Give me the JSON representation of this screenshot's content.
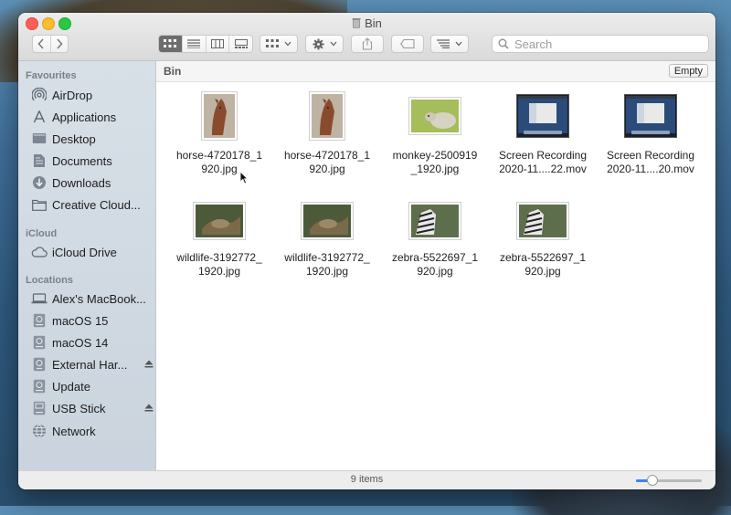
{
  "window": {
    "title": "Bin"
  },
  "toolbar": {
    "back_icon": "chevron-left-icon",
    "forward_icon": "chevron-right-icon",
    "view_modes": [
      "icon-view",
      "list-view",
      "column-view",
      "gallery-view"
    ],
    "active_view": "icon-view",
    "search_placeholder": "Search"
  },
  "sidebar": {
    "favourites_title": "Favourites",
    "favourites": [
      {
        "label": "AirDrop",
        "icon": "airdrop-icon"
      },
      {
        "label": "Applications",
        "icon": "applications-icon"
      },
      {
        "label": "Desktop",
        "icon": "desktop-icon"
      },
      {
        "label": "Documents",
        "icon": "documents-icon"
      },
      {
        "label": "Downloads",
        "icon": "downloads-icon"
      },
      {
        "label": "Creative Cloud...",
        "icon": "folder-icon"
      }
    ],
    "icloud_title": "iCloud",
    "icloud": [
      {
        "label": "iCloud Drive",
        "icon": "cloud-icon"
      }
    ],
    "locations_title": "Locations",
    "locations": [
      {
        "label": "Alex's MacBook...",
        "icon": "laptop-icon"
      },
      {
        "label": "macOS 15",
        "icon": "disk-icon"
      },
      {
        "label": "macOS 14",
        "icon": "disk-icon"
      },
      {
        "label": "External Har...",
        "icon": "external-disk-icon",
        "eject": true
      },
      {
        "label": "Update",
        "icon": "disk-icon"
      },
      {
        "label": "USB Stick",
        "icon": "usb-icon",
        "eject": true
      },
      {
        "label": "Network",
        "icon": "network-icon"
      }
    ]
  },
  "content": {
    "path_label": "Bin",
    "empty_button": "Empty",
    "files": [
      {
        "line1": "horse-4720178_1",
        "line2": "920.jpg",
        "kind": "horse"
      },
      {
        "line1": "horse-4720178_1",
        "line2": "920.jpg",
        "kind": "horse"
      },
      {
        "line1": "monkey-2500919",
        "line2": "_1920.jpg",
        "kind": "monkey"
      },
      {
        "line1": "Screen Recording",
        "line2": "2020-11....22.mov",
        "kind": "screen"
      },
      {
        "line1": "Screen Recording",
        "line2": "2020-11....20.mov",
        "kind": "screen"
      },
      {
        "line1": "wildlife-3192772_",
        "line2": "1920.jpg",
        "kind": "wildlife"
      },
      {
        "line1": "wildlife-3192772_",
        "line2": "1920.jpg",
        "kind": "wildlife"
      },
      {
        "line1": "zebra-5522697_1",
        "line2": "920.jpg",
        "kind": "zebra"
      },
      {
        "line1": "zebra-5522697_1",
        "line2": "920.jpg",
        "kind": "zebra"
      }
    ]
  },
  "statusbar": {
    "item_count": "9 items",
    "icon_size_fraction": 0.25
  }
}
